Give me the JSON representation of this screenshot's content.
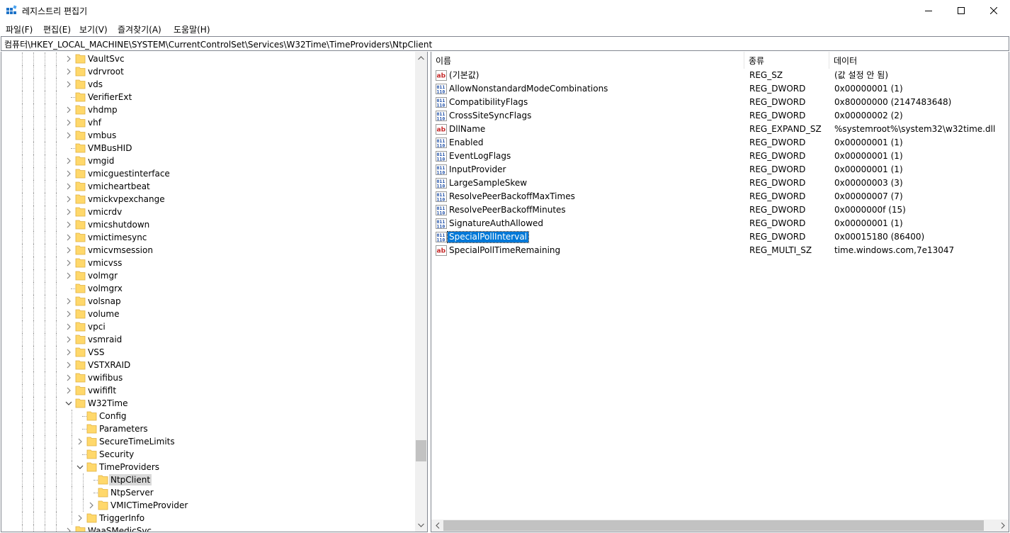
{
  "window": {
    "title": "레지스트리 편집기",
    "minimize_icon": "minimize-icon",
    "maximize_icon": "maximize-icon",
    "close_icon": "close-icon"
  },
  "menu": [
    {
      "label": "파일(F)"
    },
    {
      "label": "편집(E)"
    },
    {
      "label": "보기(V)"
    },
    {
      "label": "즐겨찾기(A)"
    },
    {
      "label": "도움말(H)"
    }
  ],
  "address": "컴퓨터\\HKEY_LOCAL_MACHINE\\SYSTEM\\CurrentControlSet\\Services\\W32Time\\TimeProviders\\NtpClient",
  "tree": [
    {
      "label": "VaultSvc",
      "level": 0,
      "expander": "collapsed"
    },
    {
      "label": "vdrvroot",
      "level": 0,
      "expander": "collapsed"
    },
    {
      "label": "vds",
      "level": 0,
      "expander": "collapsed"
    },
    {
      "label": "VerifierExt",
      "level": 0,
      "expander": "none"
    },
    {
      "label": "vhdmp",
      "level": 0,
      "expander": "collapsed"
    },
    {
      "label": "vhf",
      "level": 0,
      "expander": "collapsed"
    },
    {
      "label": "vmbus",
      "level": 0,
      "expander": "collapsed"
    },
    {
      "label": "VMBusHID",
      "level": 0,
      "expander": "none"
    },
    {
      "label": "vmgid",
      "level": 0,
      "expander": "collapsed"
    },
    {
      "label": "vmicguestinterface",
      "level": 0,
      "expander": "collapsed"
    },
    {
      "label": "vmicheartbeat",
      "level": 0,
      "expander": "collapsed"
    },
    {
      "label": "vmickvpexchange",
      "level": 0,
      "expander": "collapsed"
    },
    {
      "label": "vmicrdv",
      "level": 0,
      "expander": "collapsed"
    },
    {
      "label": "vmicshutdown",
      "level": 0,
      "expander": "collapsed"
    },
    {
      "label": "vmictimesync",
      "level": 0,
      "expander": "collapsed"
    },
    {
      "label": "vmicvmsession",
      "level": 0,
      "expander": "collapsed"
    },
    {
      "label": "vmicvss",
      "level": 0,
      "expander": "collapsed"
    },
    {
      "label": "volmgr",
      "level": 0,
      "expander": "collapsed"
    },
    {
      "label": "volmgrx",
      "level": 0,
      "expander": "none"
    },
    {
      "label": "volsnap",
      "level": 0,
      "expander": "collapsed"
    },
    {
      "label": "volume",
      "level": 0,
      "expander": "collapsed"
    },
    {
      "label": "vpci",
      "level": 0,
      "expander": "collapsed"
    },
    {
      "label": "vsmraid",
      "level": 0,
      "expander": "collapsed"
    },
    {
      "label": "VSS",
      "level": 0,
      "expander": "collapsed"
    },
    {
      "label": "VSTXRAID",
      "level": 0,
      "expander": "collapsed"
    },
    {
      "label": "vwifibus",
      "level": 0,
      "expander": "collapsed"
    },
    {
      "label": "vwififlt",
      "level": 0,
      "expander": "collapsed"
    },
    {
      "label": "W32Time",
      "level": 0,
      "expander": "expanded"
    },
    {
      "label": "Config",
      "level": 1,
      "expander": "none"
    },
    {
      "label": "Parameters",
      "level": 1,
      "expander": "none"
    },
    {
      "label": "SecureTimeLimits",
      "level": 1,
      "expander": "collapsed"
    },
    {
      "label": "Security",
      "level": 1,
      "expander": "none"
    },
    {
      "label": "TimeProviders",
      "level": 1,
      "expander": "expanded"
    },
    {
      "label": "NtpClient",
      "level": 2,
      "expander": "none",
      "selected": true
    },
    {
      "label": "NtpServer",
      "level": 2,
      "expander": "none"
    },
    {
      "label": "VMICTimeProvider",
      "level": 2,
      "expander": "collapsed"
    },
    {
      "label": "TriggerInfo",
      "level": 1,
      "expander": "collapsed"
    },
    {
      "label": "WaaSMedicSvc",
      "level": 0,
      "expander": "collapsed"
    }
  ],
  "columns": {
    "name": "이름",
    "type": "종류",
    "data": "데이터"
  },
  "values": [
    {
      "name": "(기본값)",
      "type": "REG_SZ",
      "data": "(값 설정 안 됨)",
      "icon": "string"
    },
    {
      "name": "AllowNonstandardModeCombinations",
      "type": "REG_DWORD",
      "data": "0x00000001 (1)",
      "icon": "binary"
    },
    {
      "name": "CompatibilityFlags",
      "type": "REG_DWORD",
      "data": "0x80000000 (2147483648)",
      "icon": "binary"
    },
    {
      "name": "CrossSiteSyncFlags",
      "type": "REG_DWORD",
      "data": "0x00000002 (2)",
      "icon": "binary"
    },
    {
      "name": "DllName",
      "type": "REG_EXPAND_SZ",
      "data": "%systemroot%\\system32\\w32time.dll",
      "icon": "string"
    },
    {
      "name": "Enabled",
      "type": "REG_DWORD",
      "data": "0x00000001 (1)",
      "icon": "binary"
    },
    {
      "name": "EventLogFlags",
      "type": "REG_DWORD",
      "data": "0x00000001 (1)",
      "icon": "binary"
    },
    {
      "name": "InputProvider",
      "type": "REG_DWORD",
      "data": "0x00000001 (1)",
      "icon": "binary"
    },
    {
      "name": "LargeSampleSkew",
      "type": "REG_DWORD",
      "data": "0x00000003 (3)",
      "icon": "binary"
    },
    {
      "name": "ResolvePeerBackoffMaxTimes",
      "type": "REG_DWORD",
      "data": "0x00000007 (7)",
      "icon": "binary"
    },
    {
      "name": "ResolvePeerBackoffMinutes",
      "type": "REG_DWORD",
      "data": "0x0000000f (15)",
      "icon": "binary"
    },
    {
      "name": "SignatureAuthAllowed",
      "type": "REG_DWORD",
      "data": "0x00000001 (1)",
      "icon": "binary"
    },
    {
      "name": "SpecialPollInterval",
      "type": "REG_DWORD",
      "data": "0x00015180 (86400)",
      "icon": "binary",
      "selected": true
    },
    {
      "name": "SpecialPollTimeRemaining",
      "type": "REG_MULTI_SZ",
      "data": "time.windows.com,7e13047",
      "icon": "string"
    }
  ],
  "colors": {
    "selection": "#0078d7",
    "tree_selection": "#d9d9d9",
    "folder": "#ffd86b",
    "border": "#828790"
  }
}
